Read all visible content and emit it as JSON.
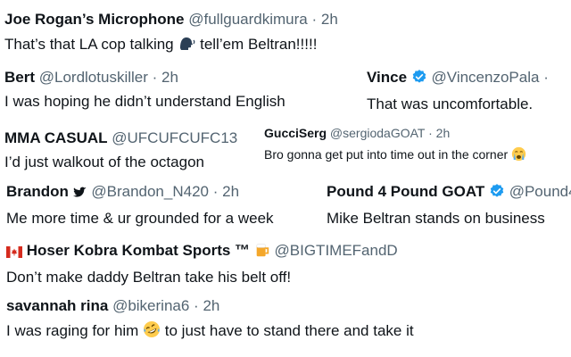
{
  "tweets": [
    {
      "name": "Joe Rogan’s Microphone",
      "handle": "@fullguardkimura",
      "sep": "·",
      "time": "2h",
      "text_before": "That’s that LA cop talking ",
      "emoji": "speaking-head-icon",
      "text_after": " tell’em Beltran!!!!!"
    },
    {
      "name": "Bert",
      "handle": "@Lordlotuskiller",
      "sep": "·",
      "time": "2h",
      "text": "I was hoping he didn’t understand English"
    },
    {
      "name": "Vince",
      "badge": "verified-badge-icon",
      "handle": "@VincenzoPala",
      "sep": "·",
      "text": "That was uncomfortable."
    },
    {
      "name": "MMA CASUAL",
      "handle": "@UFCUFCUFC13",
      "text": "I’d just walkout of the octagon"
    },
    {
      "name": "GucciSerg",
      "handle": "@sergiodaGOAT",
      "sep": "·",
      "time": "2h",
      "text": "Bro gonna get put into time out in the corner",
      "emoji": "crying-face-icon"
    },
    {
      "name": "Brandon",
      "name_icon": "bird-icon",
      "handle": "@Brandon_N420",
      "sep": "·",
      "time": "2h",
      "text": "Me more time & ur grounded for a week"
    },
    {
      "name": "Pound 4 Pound GOAT",
      "badge": "verified-badge-icon",
      "handle": "@Pound4",
      "text": "Mike Beltran stands on business"
    },
    {
      "flag": "canada-flag-icon",
      "name": "Hoser Kobra Kombat Sports ™",
      "name_emoji": "beer-mug-icon",
      "handle": "@BIGTIMEFandD",
      "text": "Don’t make daddy Beltran take his belt off!"
    },
    {
      "name": "savannah rina",
      "handle": "@bikerina6",
      "sep": "·",
      "time": "2h",
      "text_before": "I was raging for him ",
      "emoji": "rofl-face-icon",
      "text_after": " to just have to stand there and take it"
    }
  ],
  "colors": {
    "text": "#0f1419",
    "secondary": "#536471",
    "verified": "#1d9bf0"
  }
}
